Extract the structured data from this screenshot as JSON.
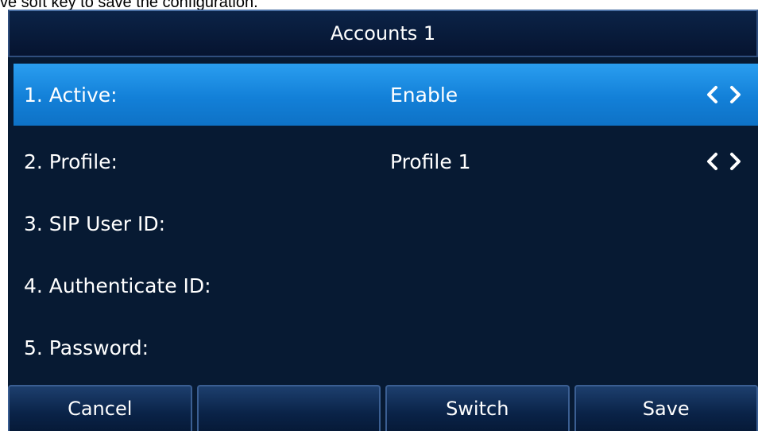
{
  "caption": "ve soft key to save the configuration.",
  "title": "Accounts 1",
  "rows": [
    {
      "label": "1. Active:",
      "value": "Enable",
      "selected": true,
      "has_arrows": true
    },
    {
      "label": "2. Profile:",
      "value": "Profile 1",
      "selected": false,
      "has_arrows": true
    },
    {
      "label": "3. SIP User ID:",
      "value": "",
      "selected": false,
      "has_arrows": false
    },
    {
      "label": "4. Authenticate ID:",
      "value": "",
      "selected": false,
      "has_arrows": false
    },
    {
      "label": "5. Password:",
      "value": "",
      "selected": false,
      "has_arrows": false
    }
  ],
  "softkeys": [
    "Cancel",
    "",
    "Switch",
    "Save"
  ],
  "icons": {
    "left": "chevron-left-icon",
    "right": "chevron-right-icon"
  },
  "colors": {
    "background": "#071a33",
    "selected": "#1a8be2",
    "text": "#ffffff"
  }
}
